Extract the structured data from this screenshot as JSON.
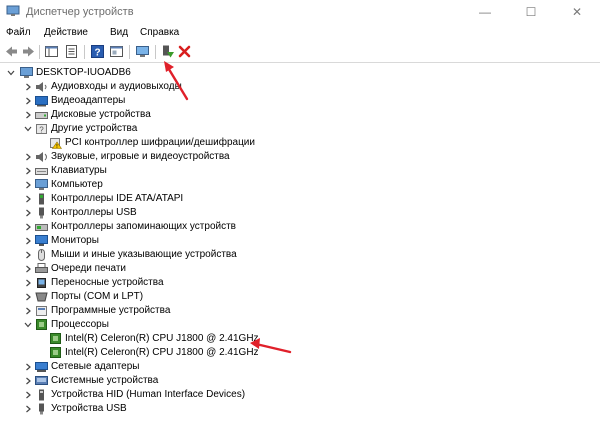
{
  "window": {
    "title": "Диспетчер устройств",
    "controls": [
      "—",
      "☐",
      "✕"
    ]
  },
  "menu": [
    "Файл",
    "Действие",
    "Вид",
    "Справка"
  ],
  "colors": {
    "arrow": "#e0202a",
    "chip": "#3a8a2a",
    "close_red": "#d81e1e",
    "help_blue": "#2a5db0"
  },
  "tree": {
    "root": "DESKTOP-IUOADB6",
    "nodes": [
      {
        "label": "Аудиовходы и аудиовыходы",
        "icon": "speaker-icon",
        "expanded": false
      },
      {
        "label": "Видеоадаптеры",
        "icon": "display-adapter-icon",
        "expanded": false
      },
      {
        "label": "Дисковые устройства",
        "icon": "disk-drive-icon",
        "expanded": false
      },
      {
        "label": "Другие устройства",
        "icon": "unknown-device-icon",
        "expanded": true,
        "children": [
          {
            "label": "PCI контроллер шифрации/дешифрации",
            "icon": "warning-device-icon"
          }
        ]
      },
      {
        "label": "Звуковые, игровые и видеоустройства",
        "icon": "sound-icon",
        "expanded": false
      },
      {
        "label": "Клавиатуры",
        "icon": "keyboard-icon",
        "expanded": false
      },
      {
        "label": "Компьютер",
        "icon": "computer-icon",
        "expanded": false
      },
      {
        "label": "Контроллеры IDE ATA/ATAPI",
        "icon": "ide-controller-icon",
        "expanded": false
      },
      {
        "label": "Контроллеры USB",
        "icon": "usb-icon",
        "expanded": false
      },
      {
        "label": "Контроллеры запоминающих устройств",
        "icon": "storage-controller-icon",
        "expanded": false
      },
      {
        "label": "Мониторы",
        "icon": "monitor-icon",
        "expanded": false
      },
      {
        "label": "Мыши и иные указывающие устройства",
        "icon": "mouse-icon",
        "expanded": false
      },
      {
        "label": "Очереди печати",
        "icon": "printer-icon",
        "expanded": false
      },
      {
        "label": "Переносные устройства",
        "icon": "portable-device-icon",
        "expanded": false
      },
      {
        "label": "Порты (COM и LPT)",
        "icon": "port-icon",
        "expanded": false
      },
      {
        "label": "Программные устройства",
        "icon": "software-device-icon",
        "expanded": false
      },
      {
        "label": "Процессоры",
        "icon": "processor-icon",
        "expanded": true,
        "children": [
          {
            "label": "Intel(R) Celeron(R) CPU  J1800  @ 2.41GHz",
            "icon": "processor-icon"
          },
          {
            "label": "Intel(R) Celeron(R) CPU  J1800  @ 2.41GHz",
            "icon": "processor-icon"
          }
        ]
      },
      {
        "label": "Сетевые адаптеры",
        "icon": "network-icon",
        "expanded": false
      },
      {
        "label": "Системные устройства",
        "icon": "system-device-icon",
        "expanded": false
      },
      {
        "label": "Устройства HID (Human Interface Devices)",
        "icon": "hid-icon",
        "expanded": false
      },
      {
        "label": "Устройства USB",
        "icon": "usb-device-icon",
        "expanded": false
      }
    ]
  }
}
